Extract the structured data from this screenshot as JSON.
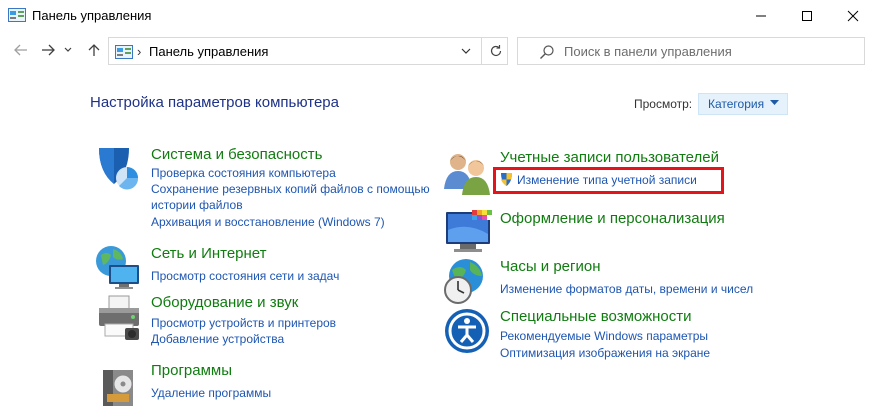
{
  "window": {
    "title": "Панель управления"
  },
  "address": {
    "crumb": "Панель управления"
  },
  "search": {
    "placeholder": "Поиск в панели управления"
  },
  "heading": "Настройка параметров компьютера",
  "view": {
    "label": "Просмотр:",
    "value": "Категория"
  },
  "categories_left": [
    {
      "title": "Система и безопасность",
      "links": [
        "Проверка состояния компьютера",
        "Сохранение резервных копий файлов с помощью",
        "истории файлов",
        "Архивация и восстановление (Windows 7)"
      ]
    },
    {
      "title": "Сеть и Интернет",
      "links": [
        "Просмотр состояния сети и задач"
      ]
    },
    {
      "title": "Оборудование и звук",
      "links": [
        "Просмотр устройств и принтеров",
        "Добавление устройства"
      ]
    },
    {
      "title": "Программы",
      "links": [
        "Удаление программы"
      ]
    }
  ],
  "categories_right": [
    {
      "title": "Учетные записи пользователей",
      "links": [
        "Изменение типа учетной записи"
      ]
    },
    {
      "title": "Оформление и персонализация",
      "links": []
    },
    {
      "title": "Часы и регион",
      "links": [
        "Изменение форматов даты, времени и чисел"
      ]
    },
    {
      "title": "Специальные возможности",
      "links": [
        "Рекомендуемые Windows параметры",
        "Оптимизация изображения на экране"
      ]
    }
  ],
  "colors": {
    "category_title": "#107c10",
    "link": "#1e56b1",
    "heading": "#1e3287",
    "highlight": "#e5131a"
  }
}
